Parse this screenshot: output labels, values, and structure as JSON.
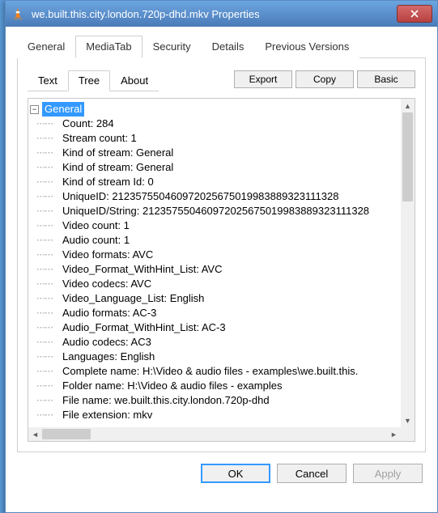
{
  "title": "we.built.this.city.london.720p-dhd.mkv Properties",
  "outer_tabs": {
    "general": "General",
    "mediatab": "MediaTab",
    "security": "Security",
    "details": "Details",
    "previous": "Previous Versions"
  },
  "inner_tabs": {
    "text": "Text",
    "tree": "Tree",
    "about": "About"
  },
  "action_buttons": {
    "export": "Export",
    "copy": "Copy",
    "basic": "Basic"
  },
  "tree": {
    "root": "General",
    "children": [
      "Count: 284",
      "Stream count: 1",
      "Kind of stream: General",
      "Kind of stream: General",
      "Kind of stream Id: 0",
      "UniqueID: 212357550460972025675019983889323111328",
      "UniqueID/String: 212357550460972025675019983889323111328",
      "Video count: 1",
      "Audio count: 1",
      "Video formats: AVC",
      "Video_Format_WithHint_List: AVC",
      "Video codecs: AVC",
      "Video_Language_List: English",
      "Audio formats: AC-3",
      "Audio_Format_WithHint_List: AC-3",
      "Audio codecs: AC3",
      "Languages: English",
      "Complete name: H:\\Video & audio files - examples\\we.built.this.",
      "Folder name: H:\\Video & audio files - examples",
      "File name: we.built.this.city.london.720p-dhd",
      "File extension: mkv"
    ]
  },
  "dialog": {
    "ok": "OK",
    "cancel": "Cancel",
    "apply": "Apply"
  }
}
